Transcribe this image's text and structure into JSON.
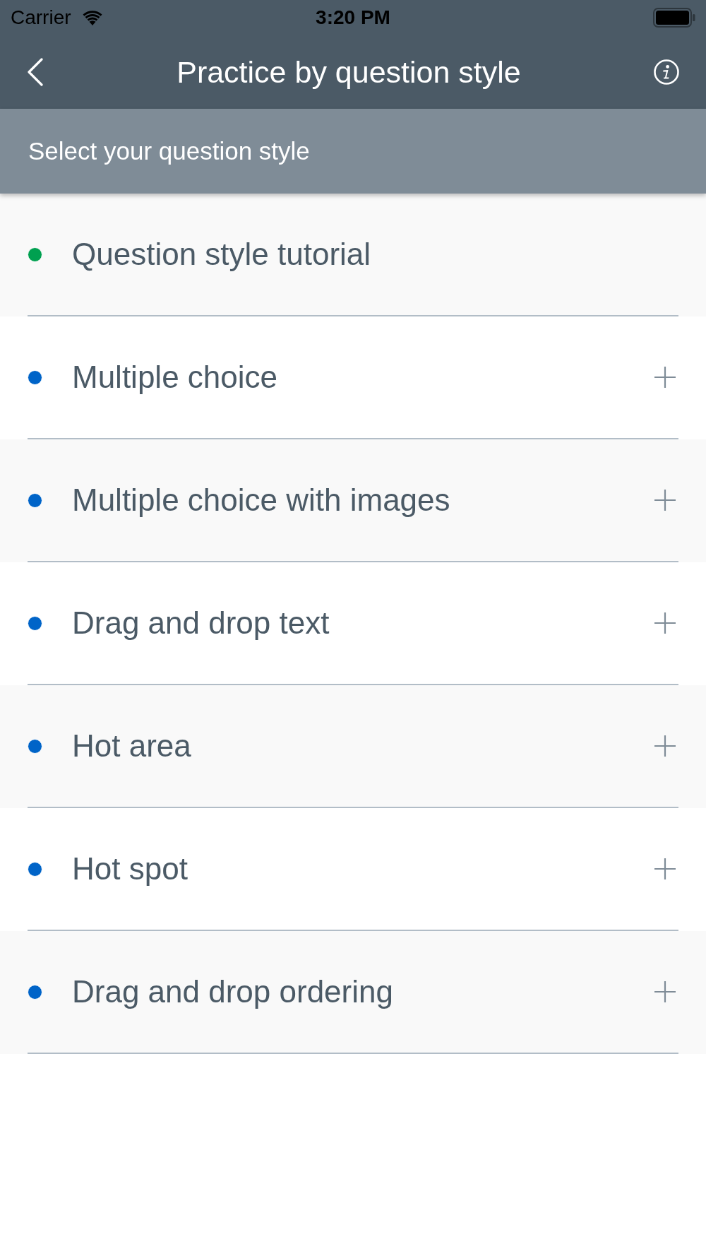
{
  "status_bar": {
    "carrier": "Carrier",
    "time": "3:20 PM"
  },
  "nav_bar": {
    "title": "Practice by question style"
  },
  "subheader": {
    "text": "Select your question style"
  },
  "styles": [
    {
      "label": "Question style tutorial",
      "kind": "tutorial",
      "color": "#00a050"
    },
    {
      "label": "Multiple choice",
      "kind": "expandable",
      "color": "#0064c8"
    },
    {
      "label": "Multiple choice with images",
      "kind": "expandable",
      "color": "#0064c8"
    },
    {
      "label": "Drag and drop text",
      "kind": "expandable",
      "color": "#0064c8"
    },
    {
      "label": "Hot area",
      "kind": "expandable",
      "color": "#0064c8"
    },
    {
      "label": "Hot spot",
      "kind": "expandable",
      "color": "#0064c8"
    },
    {
      "label": "Drag and drop ordering",
      "kind": "expandable",
      "color": "#0064c8"
    }
  ]
}
